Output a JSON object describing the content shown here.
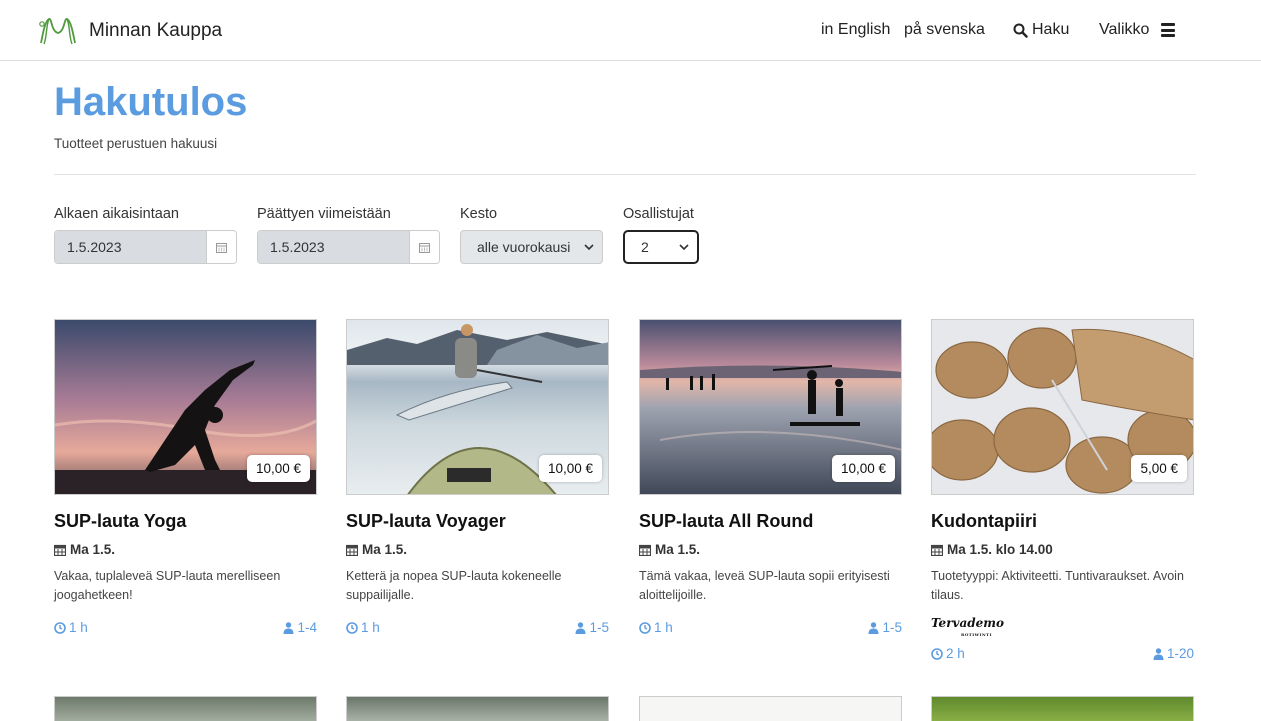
{
  "header": {
    "brand": "Minnan Kauppa",
    "lang_en": "in English",
    "lang_sv": "på svenska",
    "search_label": "Haku",
    "menu_label": "Valikko"
  },
  "page": {
    "title": "Hakutulos",
    "subtitle": "Tuotteet perustuen hakuusi"
  },
  "filters": {
    "start_label": "Alkaen aikaisintaan",
    "start_value": "1.5.2023",
    "end_label": "Päättyen viimeistään",
    "end_value": "1.5.2023",
    "duration_label": "Kesto",
    "duration_value": "alle vuorokausi",
    "participants_label": "Osallistujat",
    "participants_value": "2"
  },
  "products": [
    {
      "title": "SUP-lauta Yoga",
      "price": "10,00 €",
      "date": "Ma 1.5.",
      "description": "Vakaa, tuplaleveä SUP-lauta merelliseen joogahetkeen!",
      "duration": "1 h",
      "participants": "1-4"
    },
    {
      "title": "SUP-lauta Voyager",
      "price": "10,00 €",
      "date": "Ma 1.5.",
      "description": "Ketterä ja nopea SUP-lauta kokeneelle suppailijalle.",
      "duration": "1 h",
      "participants": "1-5"
    },
    {
      "title": "SUP-lauta All Round",
      "price": "10,00 €",
      "date": "Ma 1.5.",
      "description": "Tämä vakaa, leveä SUP-lauta sopii erityisesti aloittelijoille.",
      "duration": "1 h",
      "participants": "1-5"
    },
    {
      "title": "Kudontapiiri",
      "price": "5,00 €",
      "date": "Ma 1.5. klo 14.00",
      "description": "Tuotetyyppi: Aktiviteetti. Tuntivaraukset. Avoin tilaus.",
      "organizer_logo": "Tervademo",
      "organizer_logo_sub": "ROTIWINTI",
      "duration": "2 h",
      "participants": "1-20"
    }
  ],
  "colors": {
    "accent": "#5b9be0",
    "logo_green": "#4e9a3c"
  },
  "icons": {
    "calendar": "calendar-icon",
    "clock": "clock-icon",
    "user": "user-icon",
    "search": "search-icon",
    "menu": "hamburger-icon"
  }
}
